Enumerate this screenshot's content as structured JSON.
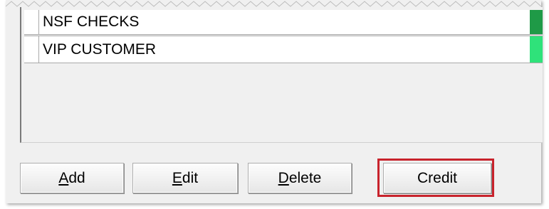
{
  "list": {
    "items": [
      {
        "label": "NSF CHECKS",
        "color": "#1f9a47"
      },
      {
        "label": "VIP CUSTOMER",
        "color": "#2fe27a"
      }
    ]
  },
  "buttons": {
    "add": {
      "mnemonic": "A",
      "rest": "dd"
    },
    "edit": {
      "mnemonic": "E",
      "rest": "dit"
    },
    "delete": {
      "mnemonic": "D",
      "rest": "elete"
    },
    "credit": {
      "label": "Credit"
    }
  },
  "colors": {
    "highlight": "#c8232c",
    "panel_bg": "#f0f0f0"
  }
}
